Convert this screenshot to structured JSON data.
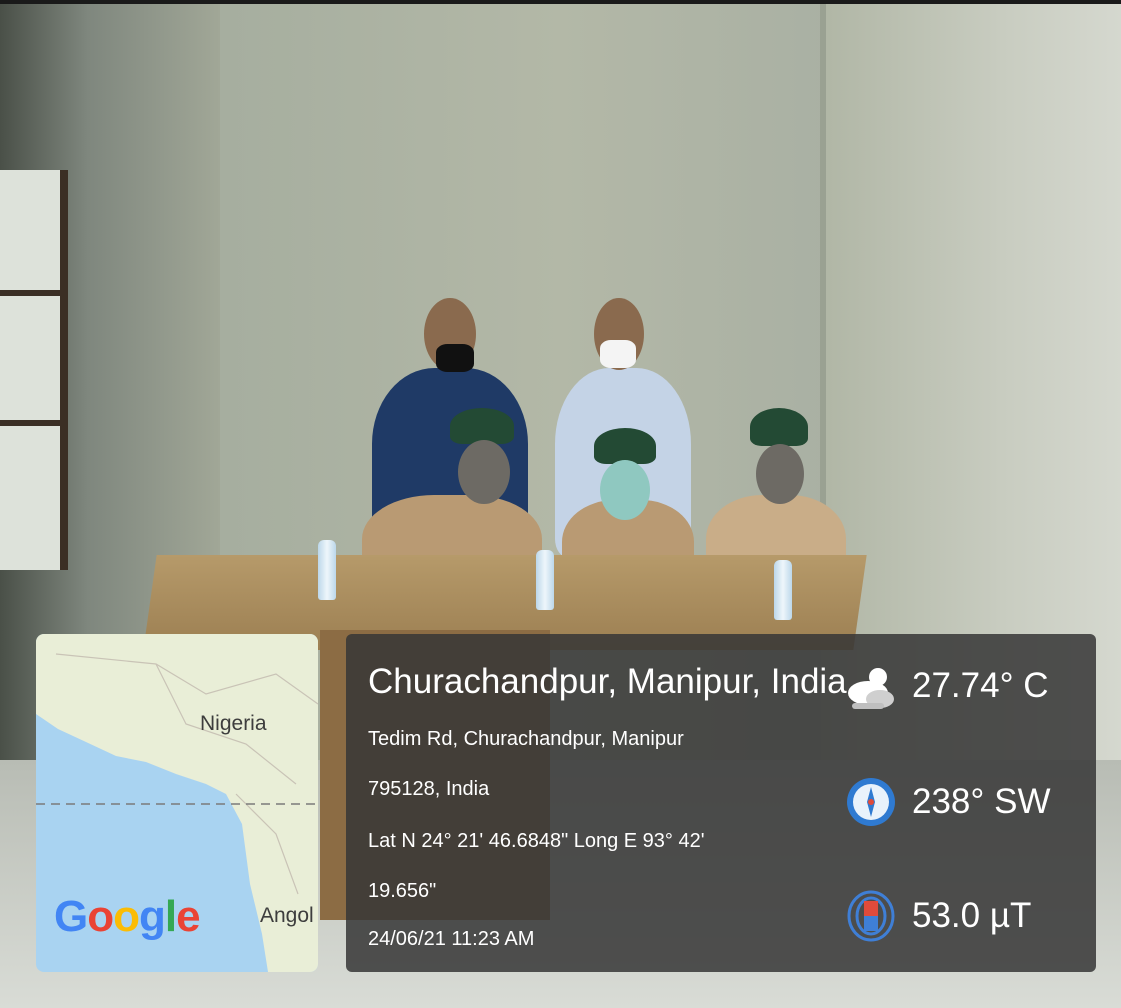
{
  "map": {
    "label_country_1": "Nigeria",
    "label_country_2": "Angol",
    "logo_letters": [
      "G",
      "o",
      "o",
      "g",
      "l",
      "e"
    ]
  },
  "location": {
    "place_name": "Churachandpur, Manipur, India",
    "address_line_1": "Tedim Rd, Churachandpur, Manipur",
    "address_line_2": "795128, India",
    "coords_line_1": "Lat N 24° 21' 46.6848\" Long E 93° 42'",
    "coords_line_2": "19.656\"",
    "datetime": "24/06/21 11:23 AM"
  },
  "readings": {
    "temperature": "27.74° C",
    "wind_direction": "238° SW",
    "magnetic_field": "53.0 µT"
  },
  "icons": {
    "temperature": "cloud-sun-icon",
    "wind": "compass-icon",
    "magnet": "magnet-icon"
  },
  "colors": {
    "overlay": "#373737",
    "map_sea": "#a9d3f1",
    "map_land": "#e9eed7"
  }
}
